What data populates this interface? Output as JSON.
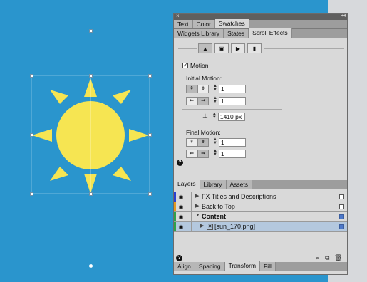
{
  "panel": {
    "top_tabs": [
      "Text",
      "Color",
      "Swatches"
    ],
    "active_top_tab": "Swatches",
    "sub_tabs": [
      "Widgets Library",
      "States",
      "Scroll Effects"
    ],
    "active_sub_tab": "Scroll Effects",
    "motion_label": "Motion",
    "motion_checked": true,
    "initial_motion_label": "Initial Motion:",
    "initial_vertical_value": "1",
    "initial_horizontal_value": "1",
    "position_value": "1410 px",
    "final_motion_label": "Final Motion:",
    "final_vertical_value": "1",
    "final_horizontal_value": "1",
    "help": "?",
    "close": "×",
    "collapse": "◂◂"
  },
  "layers_panel": {
    "tabs": [
      "Layers",
      "Library",
      "Assets"
    ],
    "active_tab": "Layers",
    "rows": [
      {
        "name": "FX Titles and Descriptions",
        "color": "#2a3fd0",
        "expanded": false,
        "indent": 0
      },
      {
        "name": "Back to Top",
        "color": "#e39a1e",
        "expanded": false,
        "indent": 0
      },
      {
        "name": "Content",
        "color": "#2ea24a",
        "expanded": true,
        "indent": 0,
        "bold": true
      },
      {
        "name": "[sun_170.png]",
        "color": "#2ea24a",
        "expanded": false,
        "indent": 1,
        "selected": true
      }
    ]
  },
  "bottom_tabs": [
    "Align",
    "Spacing",
    "Transform",
    "Fill"
  ],
  "active_bottom_tab": "Transform",
  "colors": {
    "canvas": "#2a95cd",
    "sun": "#f6e552",
    "panel_bg": "#d9d9d9"
  },
  "icons": {
    "eraser": "eraser-icon",
    "frame": "frame-icon",
    "play": "play-icon",
    "pin": "pin-icon",
    "eye": "eye-icon",
    "search": "search-icon",
    "new_layer": "new-layer-icon",
    "trash": "trash-icon"
  }
}
